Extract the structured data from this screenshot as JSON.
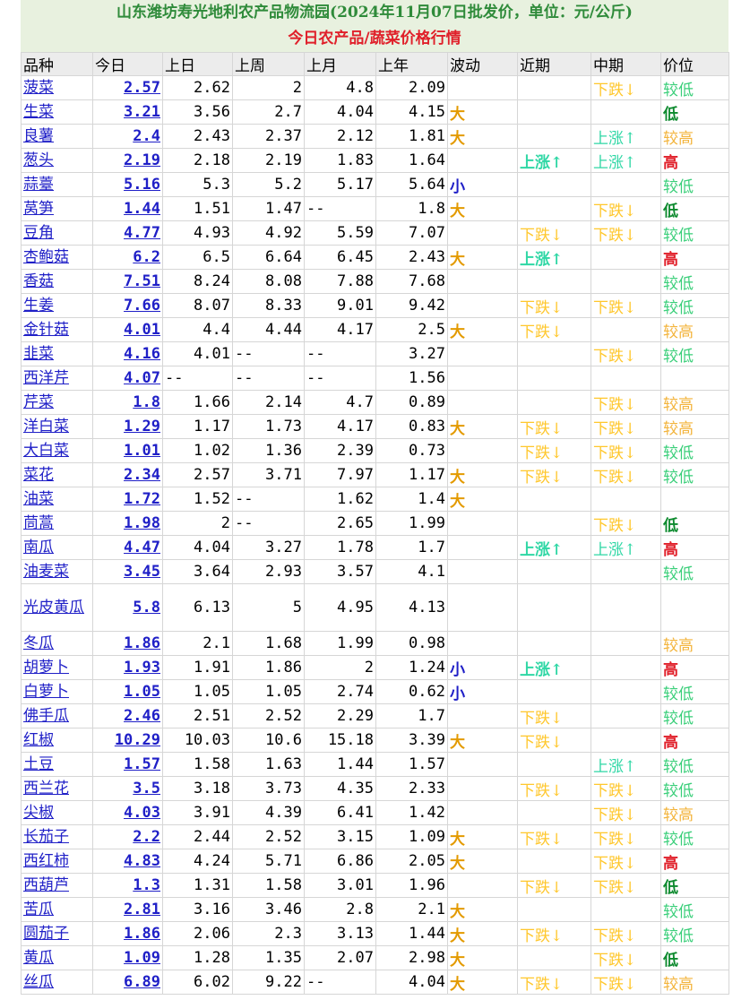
{
  "title_line1": "山东潍坊寿光地利农产品物流园(2024年11月07日批发价，单位：元/公斤)",
  "title_line2": "今日农产品/蔬菜价格行情",
  "columns": [
    "品种",
    "今日",
    "上日",
    "上周",
    "上月",
    "上年",
    "波动",
    "近期",
    "中期",
    "价位"
  ],
  "colors": {
    "link": "#1f1fc7",
    "up": "#2fd7a5",
    "down": "#ffc72c",
    "high": "#e0202a",
    "low": "#3bcf7a",
    "title": "#2f8b3a"
  },
  "rows": [
    [
      "菠菜",
      "2.57",
      "2.62",
      "2",
      "4.8",
      "2.09",
      "",
      "",
      "下跌↓",
      "较低"
    ],
    [
      "生菜",
      "3.21",
      "3.56",
      "2.7",
      "4.04",
      "4.15",
      "大",
      "",
      "",
      "低"
    ],
    [
      "良薯",
      "2.4",
      "2.43",
      "2.37",
      "2.12",
      "1.81",
      "大",
      "",
      "上涨↑",
      "较高"
    ],
    [
      "葱头",
      "2.19",
      "2.18",
      "2.19",
      "1.83",
      "1.64",
      "",
      "上涨↑",
      "上涨↑",
      "高"
    ],
    [
      "蒜薹",
      "5.16",
      "5.3",
      "5.2",
      "5.17",
      "5.64",
      "小",
      "",
      "",
      "较低"
    ],
    [
      "莴笋",
      "1.44",
      "1.51",
      "1.47",
      "--",
      "1.8",
      "大",
      "",
      "下跌↓",
      "低"
    ],
    [
      "豆角",
      "4.77",
      "4.93",
      "4.92",
      "5.59",
      "7.07",
      "",
      "下跌↓",
      "下跌↓",
      "较低"
    ],
    [
      "杏鲍菇",
      "6.2",
      "6.5",
      "6.64",
      "6.45",
      "2.43",
      "大",
      "上涨↑",
      "",
      "高"
    ],
    [
      "香菇",
      "7.51",
      "8.24",
      "8.08",
      "7.88",
      "7.68",
      "",
      "",
      "",
      "较低"
    ],
    [
      "生姜",
      "7.66",
      "8.07",
      "8.33",
      "9.01",
      "9.42",
      "",
      "下跌↓",
      "下跌↓",
      "较低"
    ],
    [
      "金针菇",
      "4.01",
      "4.4",
      "4.44",
      "4.17",
      "2.5",
      "大",
      "下跌↓",
      "",
      "较高"
    ],
    [
      "韭菜",
      "4.16",
      "4.01",
      "--",
      "--",
      "3.27",
      "",
      "",
      "下跌↓",
      "较低"
    ],
    [
      "西洋芹",
      "4.07",
      "--",
      "--",
      "--",
      "1.56",
      "",
      "",
      "",
      ""
    ],
    [
      "芹菜",
      "1.8",
      "1.66",
      "2.14",
      "4.7",
      "0.89",
      "",
      "",
      "下跌↓",
      "较高"
    ],
    [
      "洋白菜",
      "1.29",
      "1.17",
      "1.73",
      "4.17",
      "0.83",
      "大",
      "下跌↓",
      "下跌↓",
      "较高"
    ],
    [
      "大白菜",
      "1.01",
      "1.02",
      "1.36",
      "2.39",
      "0.73",
      "",
      "下跌↓",
      "下跌↓",
      "较低"
    ],
    [
      "菜花",
      "2.34",
      "2.57",
      "3.71",
      "7.97",
      "1.17",
      "大",
      "下跌↓",
      "下跌↓",
      "较低"
    ],
    [
      "油菜",
      "1.72",
      "1.52",
      "--",
      "1.62",
      "1.4",
      "大",
      "",
      "",
      ""
    ],
    [
      "茼蒿",
      "1.98",
      "2",
      "--",
      "2.65",
      "1.99",
      "",
      "",
      "下跌↓",
      "低"
    ],
    [
      "南瓜",
      "4.47",
      "4.04",
      "3.27",
      "1.78",
      "1.7",
      "",
      "上涨↑",
      "上涨↑",
      "高"
    ],
    [
      "油麦菜",
      "3.45",
      "3.64",
      "2.93",
      "3.57",
      "4.1",
      "",
      "",
      "",
      "较低"
    ],
    [
      "光皮黄瓜",
      "5.8",
      "6.13",
      "5",
      "4.95",
      "4.13",
      "",
      "",
      "",
      ""
    ],
    [
      "冬瓜",
      "1.86",
      "2.1",
      "1.68",
      "1.99",
      "0.98",
      "",
      "",
      "",
      "较高"
    ],
    [
      "胡萝卜",
      "1.93",
      "1.91",
      "1.86",
      "2",
      "1.24",
      "小",
      "上涨↑",
      "",
      "高"
    ],
    [
      "白萝卜",
      "1.05",
      "1.05",
      "1.05",
      "2.74",
      "0.62",
      "小",
      "",
      "",
      "较低"
    ],
    [
      "佛手瓜",
      "2.46",
      "2.51",
      "2.52",
      "2.29",
      "1.7",
      "",
      "下跌↓",
      "",
      "较低"
    ],
    [
      "红椒",
      "10.29",
      "10.03",
      "10.6",
      "15.18",
      "3.39",
      "大",
      "下跌↓",
      "",
      "高"
    ],
    [
      "土豆",
      "1.57",
      "1.58",
      "1.63",
      "1.44",
      "1.57",
      "",
      "",
      "上涨↑",
      "较低"
    ],
    [
      "西兰花",
      "3.5",
      "3.18",
      "3.73",
      "4.35",
      "2.33",
      "",
      "下跌↓",
      "下跌↓",
      "较低"
    ],
    [
      "尖椒",
      "4.03",
      "3.91",
      "4.39",
      "6.41",
      "1.42",
      "",
      "",
      "下跌↓",
      "较高"
    ],
    [
      "长茄子",
      "2.2",
      "2.44",
      "2.52",
      "3.15",
      "1.09",
      "大",
      "下跌↓",
      "下跌↓",
      "较低"
    ],
    [
      "西红柿",
      "4.83",
      "4.24",
      "5.71",
      "6.86",
      "2.05",
      "大",
      "",
      "下跌↓",
      "高"
    ],
    [
      "西葫芦",
      "1.3",
      "1.31",
      "1.58",
      "3.01",
      "1.96",
      "",
      "下跌↓",
      "下跌↓",
      "低"
    ],
    [
      "苦瓜",
      "2.81",
      "3.16",
      "3.46",
      "2.8",
      "2.1",
      "大",
      "",
      "",
      "较低"
    ],
    [
      "圆茄子",
      "1.86",
      "2.06",
      "2.3",
      "3.13",
      "1.44",
      "大",
      "下跌↓",
      "下跌↓",
      "较低"
    ],
    [
      "黄瓜",
      "1.09",
      "1.28",
      "1.35",
      "2.07",
      "2.98",
      "大",
      "",
      "下跌↓",
      "低"
    ],
    [
      "丝瓜",
      "6.89",
      "6.02",
      "9.22",
      "--",
      "4.04",
      "大",
      "下跌↓",
      "下跌↓",
      "较高"
    ]
  ]
}
